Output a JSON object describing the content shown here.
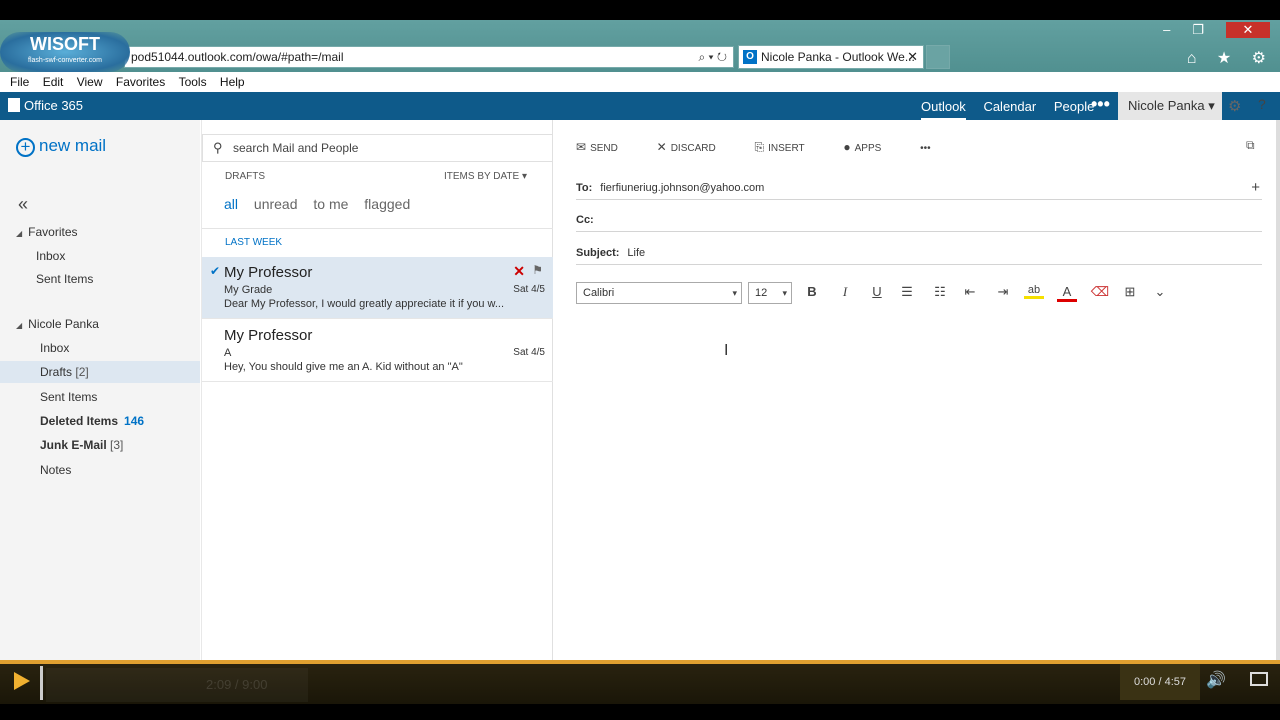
{
  "browser": {
    "url": "pod51044.outlook.com/owa/#path=/mail",
    "address_icons": "⌕ ▾ ↻",
    "tab_title": "Nicole Panka - Outlook We...",
    "tab_icon_letter": "O",
    "tab_close": "✕",
    "window_controls": {
      "minimize": "–",
      "restore": "❐",
      "close": "✕"
    },
    "nav_icons": "⌂ ★ ⚙",
    "menu": [
      "File",
      "Edit",
      "View",
      "Favorites",
      "Tools",
      "Help"
    ]
  },
  "watermark": {
    "title": "WISOFT",
    "subtitle": "flash-swf-converter.com"
  },
  "o365": {
    "brand": "Office 365",
    "nav": [
      "Outlook",
      "Calendar",
      "People"
    ],
    "more": "•••",
    "user": "Nicole Panka ▾",
    "settings_icon": "⚙",
    "help_icon": "?"
  },
  "leftnav": {
    "new_mail": "new mail",
    "new_mail_icon": "+",
    "collapse": "«",
    "favorites_header": "Favorites",
    "favorites": [
      "Inbox",
      "Sent Items"
    ],
    "account_header": "Nicole Panka",
    "folders": [
      {
        "name": "Inbox"
      },
      {
        "name": "Drafts",
        "count": "[2]"
      },
      {
        "name": "Sent Items"
      },
      {
        "name": "Deleted Items",
        "count": "146"
      },
      {
        "name": "Junk E-Mail",
        "count": "[3]"
      },
      {
        "name": "Notes"
      }
    ]
  },
  "msglist": {
    "search_placeholder": "search Mail and People",
    "search_icon": "⚲",
    "folder": "DRAFTS",
    "sort": "ITEMS BY DATE ▾",
    "filters": [
      "all",
      "unread",
      "to me",
      "flagged"
    ],
    "group": "LAST WEEK",
    "messages": [
      {
        "from": "My Professor",
        "subject": "My Grade",
        "preview": "Dear My Professor, I would greatly appreciate it if you w...",
        "date": "Sat 4/5",
        "check": "✔",
        "delete": "✕",
        "flag": "⚑"
      },
      {
        "from": "My Professor",
        "subject": "A",
        "preview": "Hey, You should give me an A. Kid without an \"A\"",
        "date": "Sat 4/5"
      }
    ]
  },
  "compose": {
    "toolbar": {
      "send": "SEND",
      "send_icon": "✉",
      "discard": "DISCARD",
      "discard_icon": "✕",
      "insert": "INSERT",
      "insert_icon": "⎘",
      "apps": "APPS",
      "apps_icon": "●",
      "more": "•••"
    },
    "popout_icon": "⧉",
    "to_label": "To:",
    "to_value": "fierfiuneriug.johnson@yahoo.com",
    "add_icon": "+",
    "cc_label": "Cc:",
    "subject_label": "Subject:",
    "subject_value": "Life",
    "font": "Calibri",
    "size": "12",
    "caret": "▾",
    "format_buttons": {
      "bold": "B",
      "italic": "I",
      "underline": "U",
      "bullets": "☰",
      "numbering": "☷",
      "decrease_indent": "⇤",
      "increase_indent": "⇥",
      "highlight": "ab",
      "font_color": "A",
      "clear_format": "⌫",
      "table": "⊞",
      "more": "⌄"
    },
    "cursor": "I"
  },
  "player": {
    "time": "0:00 / 4:57",
    "volume_icon": "🔊",
    "ghost_time": "2:09 / 9:00"
  },
  "colors": {
    "accent": "#0072c6",
    "o365_bar": "#0e5a8a",
    "selected_bg": "#dde7f1"
  }
}
